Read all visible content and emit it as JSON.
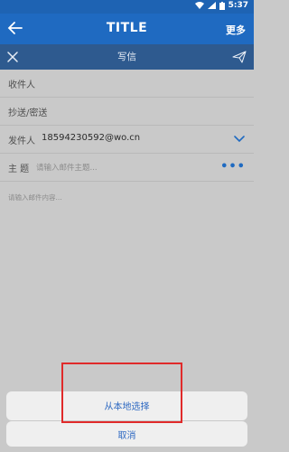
{
  "statusbar": {
    "time": "5:37",
    "icons": [
      "wifi-icon",
      "signal-icon",
      "battery-icon"
    ]
  },
  "appbar": {
    "title": "TITLE",
    "more": "更多"
  },
  "subbar": {
    "title": "写信"
  },
  "form": {
    "to_label": "收件人",
    "cc_label": "抄送/密送",
    "from_label": "发件人",
    "from_value": "18594230592@wo.cn",
    "subject_label": "主 题",
    "subject_placeholder": "请输入邮件主题...",
    "body_placeholder": "请输入邮件内容..."
  },
  "sheet": {
    "local_select": "从本地选择",
    "cancel": "取消"
  },
  "colors": {
    "primary": "#1f6ac1",
    "subbar": "#2e5a8f",
    "accent_text": "#2e69c2",
    "highlight": "#e02a2a"
  }
}
